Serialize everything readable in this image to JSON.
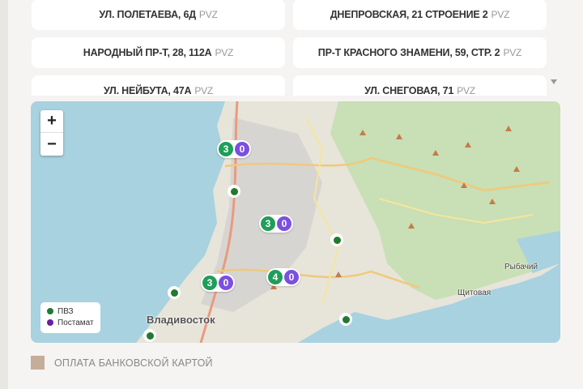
{
  "addresses": [
    {
      "label": "УЛ. ПОЛЕТАЕВА, 6Д",
      "tag": "PVZ"
    },
    {
      "label": "ДНЕПРОВСКАЯ, 21 СТРОЕНИЕ 2",
      "tag": "PVZ"
    },
    {
      "label": "НАРОДНЫЙ ПР-Т, 28, 112А",
      "tag": "PVZ"
    },
    {
      "label": "ПР-Т КРАСНОГО ЗНАМЕНИ, 59, СТР. 2",
      "tag": "PVZ"
    },
    {
      "label": "УЛ. НЕЙБУТА, 47А",
      "tag": "PVZ"
    },
    {
      "label": "УЛ. СНЕГОВАЯ, 71",
      "tag": "PVZ"
    }
  ],
  "map": {
    "zoom_in": "+",
    "zoom_out": "−",
    "clusters": [
      {
        "pvz": "3",
        "postamat": "0"
      },
      {
        "pvz": "3",
        "postamat": "0"
      },
      {
        "pvz": "3",
        "postamat": "0"
      },
      {
        "pvz": "4",
        "postamat": "0"
      }
    ],
    "labels": {
      "city": "Владивосток",
      "rybachiy": "Рыбачий",
      "shchitovaya": "Щитовая"
    },
    "legend": {
      "pvz": "ПВЗ",
      "postamat": "Постамат"
    },
    "colors": {
      "pvz": "#1f9e5a",
      "postamat": "#7b4fe0"
    }
  },
  "payment": {
    "label": "ОПЛАТА БАНКОВСКОЙ КАРТОЙ",
    "color": "#c4ad99"
  }
}
